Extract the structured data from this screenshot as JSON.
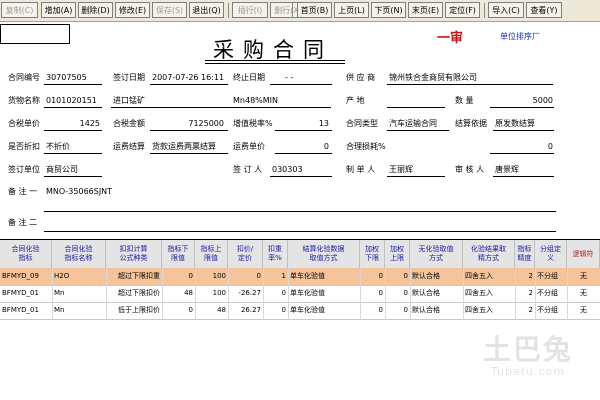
{
  "toolbar": {
    "copy": "复制(C)",
    "add": "增加(A)",
    "delete": "删除(D)",
    "modify": "修改(E)",
    "save": "保存(S)",
    "exit": "退出(Q)",
    "insert_row": "插行(I)",
    "delete_row": "删行(X)",
    "first": "首页(B)",
    "prev": "上页(L)",
    "next": "下页(N)",
    "last": "末页(E)",
    "locate": "定位(F)",
    "import": "导入(C)",
    "view": "查看(Y)"
  },
  "header": {
    "title": "采购合同",
    "stamp": "一审",
    "sort_label": "单位排序厂"
  },
  "form": {
    "contract_no_label": "合同编号",
    "contract_no": "30707505",
    "sign_date_label": "签订日期",
    "sign_date": "2007-07-26 16:11",
    "end_date_label": "终止日期",
    "end_date": "- -",
    "supplier_label": "供 应 商",
    "supplier": "锦州铁合金商贸有限公司",
    "goods_name_label": "货物名称",
    "goods_code": "0101020151",
    "goods_name": "进口锰矿",
    "goods_spec": "Mn48%MIN",
    "origin_label": "产    地",
    "origin": "",
    "quantity_label": "数    量",
    "quantity": "5000",
    "tax_price_label": "合税单价",
    "tax_price": "1425",
    "tax_amount_label": "合税金额",
    "tax_amount": "7125000",
    "vat_rate_label": "增值税率%",
    "vat_rate": "13",
    "contract_type_label": "合同类型",
    "contract_type": "汽车运输合同",
    "settle_basis_label": "结算依据",
    "settle_basis": "原发数结算",
    "discount_label": "是否折扣",
    "discount": "不折价",
    "freight_settle_label": "运费结算",
    "freight_settle": "货款运费两票结算",
    "freight_price_label": "运费单价",
    "freight_price": "0",
    "reasonable_loss_label": "合理损耗%",
    "reasonable_loss": "0",
    "sign_unit_label": "签订单位",
    "sign_unit": "商贸公司",
    "signer_label": "签 订 人",
    "signer": "030303",
    "maker_label": "制 单 人",
    "maker": "王丽辉",
    "reviewer_label": "审 核 人",
    "reviewer": "唐景辉",
    "remark1_label": "备 注 一",
    "remark1": "MNO-35066SJNT",
    "remark2_label": "备 注 二",
    "remark2": ""
  },
  "grid": {
    "headers": [
      "合同化验\n指标",
      "合同化验\n指标名称",
      "扣扣计算\n公式种类",
      "指标下\n限值",
      "指标上\n限值",
      "扣价/\n定价",
      "扣重\n率%",
      "结算化验数据\n取值方式",
      "加权\n下限",
      "加权\n上限",
      "无化验取值\n方式",
      "化验结果取\n精方式",
      "指标\n精度",
      "分组定\n义",
      "逻辑符"
    ],
    "rows": [
      [
        "BFMYD_09",
        "H2O",
        "超过下限扣重",
        "0",
        "100",
        "0",
        "1",
        "单车化验值",
        "0",
        "0",
        "默认合格",
        "四舍五入",
        "2",
        "不分组",
        "无"
      ],
      [
        "BFMYD_01",
        "Mn",
        "超过下限扣价",
        "48",
        "100",
        "-26.27",
        "0",
        "单车化验值",
        "0",
        "0",
        "默认合格",
        "四舍五入",
        "2",
        "不分组",
        "无"
      ],
      [
        "BFMYD_01",
        "Mn",
        "低于上限扣价",
        "0",
        "48",
        "26.27",
        "0",
        "单车化验值",
        "0",
        "0",
        "默认合格",
        "四舍五入",
        "2",
        "不分组",
        "无"
      ]
    ]
  },
  "watermark": {
    "big": "土巴兔",
    "small": "Tubatu.com"
  }
}
